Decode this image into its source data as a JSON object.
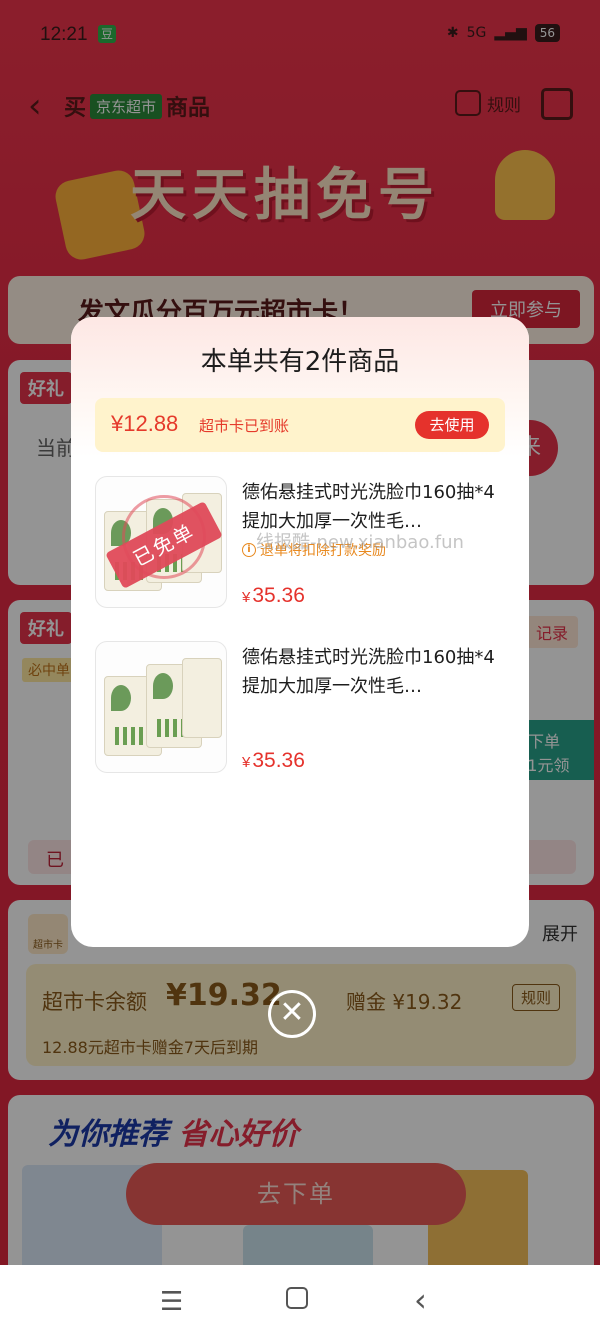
{
  "status_bar": {
    "time": "12:21",
    "app_badge": "豆",
    "network": "5G",
    "battery": "56"
  },
  "nav": {
    "prefix": "买",
    "tag": "京东超市",
    "suffix": "商品",
    "rules_label": "规则"
  },
  "hero": {
    "title": "天天抽免号"
  },
  "banner": {
    "text": "发文瓜分百万元超市卡！",
    "button": "立即参与"
  },
  "card1": {
    "tag": "好礼",
    "text": "当前",
    "round_label": "来"
  },
  "card2": {
    "tag": "好礼",
    "tab": "记录",
    "sub": "必中单",
    "badge_line1": "卡下单",
    "badge_line2": "0.1元领",
    "foot": "已"
  },
  "wallet": {
    "icon_label": "超市卡",
    "expand": "展开",
    "balance_label": "超市卡余额",
    "balance_currency": "¥",
    "balance_amount": "19.32",
    "gift_label": "赠金 ¥19.32",
    "rule": "规则",
    "note": "12.88元超市卡赠金7天后到期"
  },
  "recommend": {
    "title_a": "为你推荐",
    "title_b": "省心好价"
  },
  "order_button": "去下单",
  "modal": {
    "title": "本单共有2件商品",
    "reward": {
      "amount": "¥12.88",
      "text": "超市卡已到账",
      "button": "去使用"
    },
    "products": [
      {
        "name": "德佑悬挂式时光洗脸巾160抽*4提加大加厚一次性毛…",
        "stamp": "已免单",
        "warning": "退单将扣除打款奖励",
        "currency": "¥",
        "price": "35.36"
      },
      {
        "name": "德佑悬挂式时光洗脸巾160抽*4提加大加厚一次性毛…",
        "currency": "¥",
        "price": "35.36"
      }
    ]
  },
  "watermark": "线报酷-new.xianbao.fun",
  "icons": {
    "back": "chevron-left-icon",
    "rules": "document-icon",
    "share": "share-icon",
    "close": "close-icon",
    "warning": "info-icon",
    "sys_menu": "menu-icon",
    "sys_home": "home-icon",
    "sys_back": "back-icon"
  },
  "colors": {
    "accent_red": "#e5322c",
    "reward_bg": "#fff3cc",
    "warning_orange": "#e8891f"
  }
}
